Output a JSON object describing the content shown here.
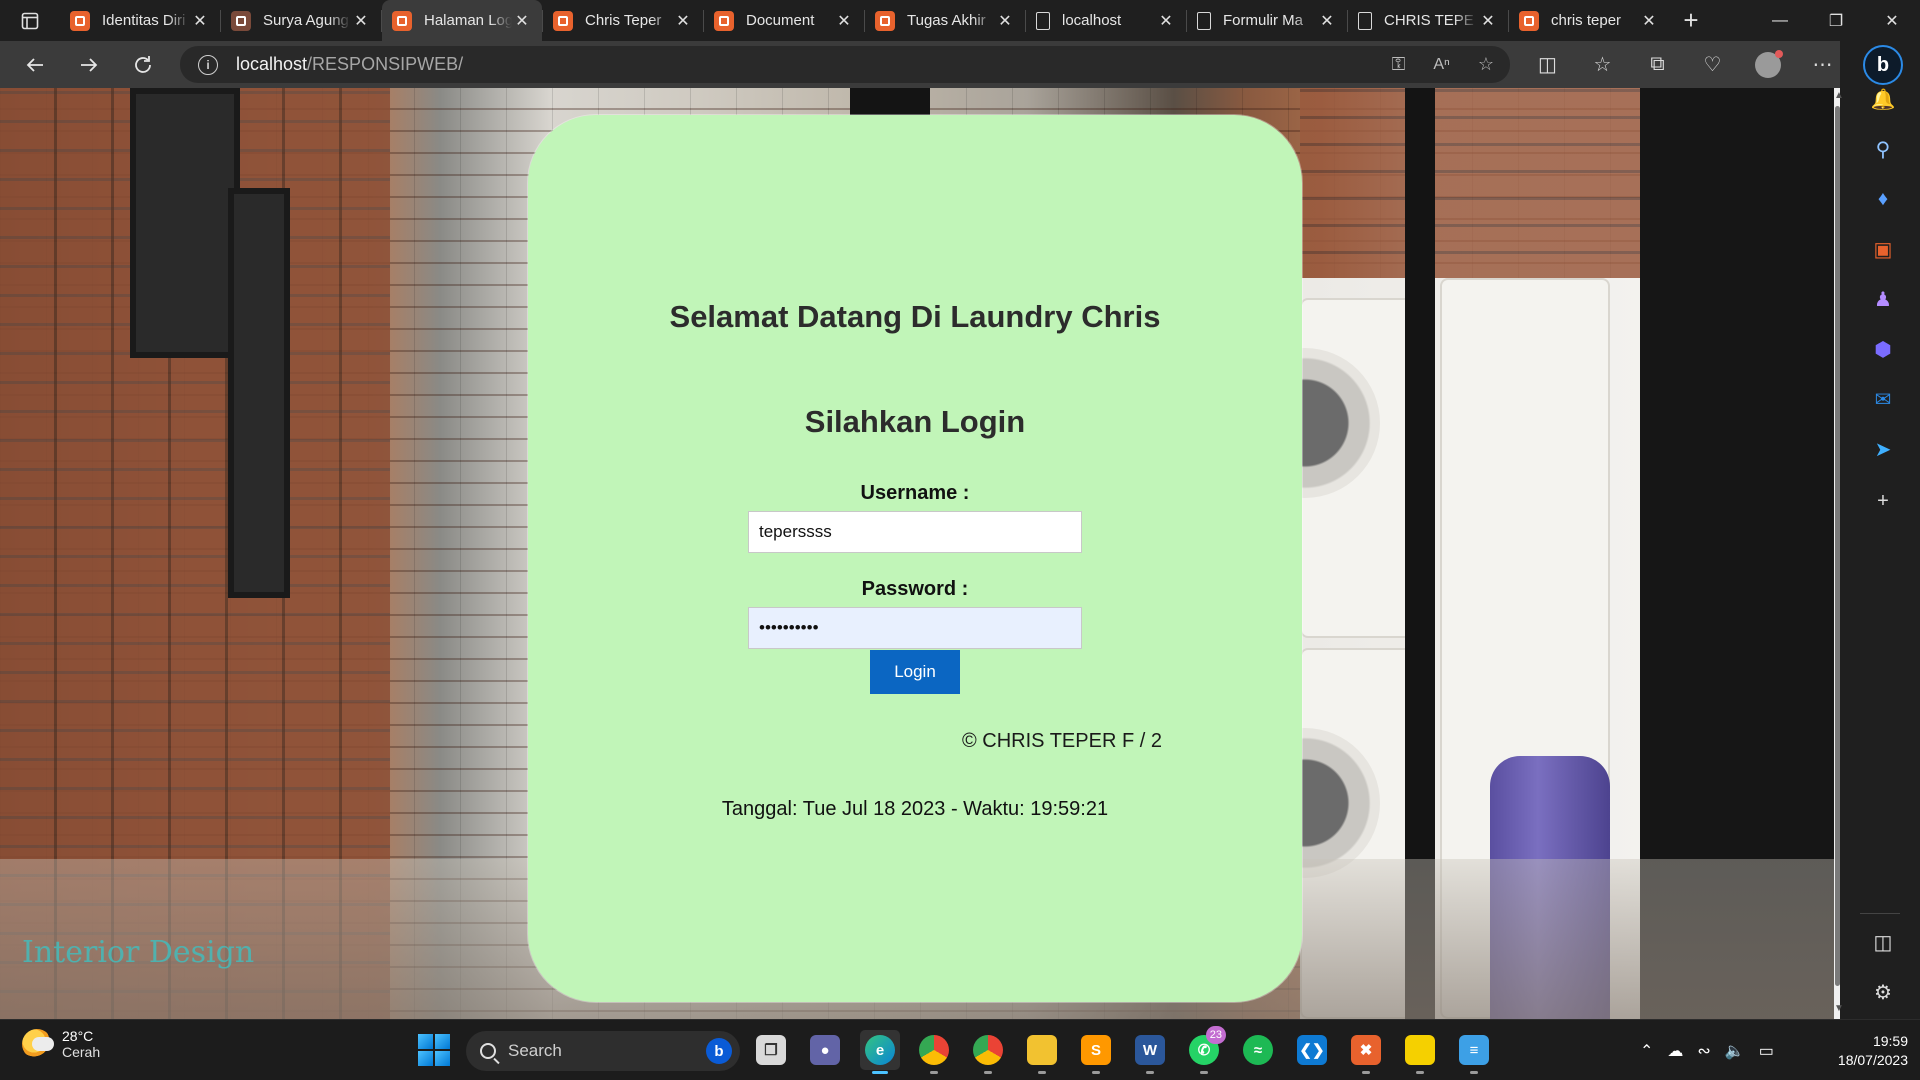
{
  "browser": {
    "tabs": [
      {
        "title": "Identitas Diri",
        "favicon": "xampp-icon",
        "active": false
      },
      {
        "title": "Surya Agung",
        "favicon": "xampp-icon",
        "active": false
      },
      {
        "title": "Halaman Login",
        "favicon": "xampp-icon",
        "active": true
      },
      {
        "title": "Chris Teper",
        "favicon": "xampp-icon",
        "active": false
      },
      {
        "title": "Document",
        "favicon": "xampp-icon",
        "active": false
      },
      {
        "title": "Tugas Akhir",
        "favicon": "xampp-icon",
        "active": false
      },
      {
        "title": "localhost",
        "favicon": "puzzle-page-icon",
        "active": false
      },
      {
        "title": "Formulir Ma",
        "favicon": "page-icon",
        "active": false
      },
      {
        "title": "CHRIS TEPE",
        "favicon": "page-icon",
        "active": false
      },
      {
        "title": "chris teper",
        "favicon": "xampp-icon",
        "active": false
      }
    ],
    "address": {
      "host": "localhost",
      "path": "/RESPONSIPWEB/"
    }
  },
  "page": {
    "title": "Selamat Datang Di Laundry Chris",
    "subtitle": "Silahkan Login",
    "username_label": "Username :",
    "username_value": "teperssss",
    "password_label": "Password :",
    "password_value": "••••••••••",
    "login_button": "Login",
    "copyright": "© CHRIS TEPER F / 2",
    "datetime": "Tanggal: Tue Jul 18 2023 - Waktu: 19:59:21",
    "watermark": "Interior Design"
  },
  "taskbar": {
    "weather_temp": "28°C",
    "weather_condition": "Cerah",
    "search_placeholder": "Search",
    "whatsapp_badge": "23",
    "time": "19:59",
    "date": "18/07/2023"
  },
  "colors": {
    "card_background": "#c1f5b8",
    "login_button": "#0b66c2",
    "xampp_orange": "#e8622d"
  }
}
